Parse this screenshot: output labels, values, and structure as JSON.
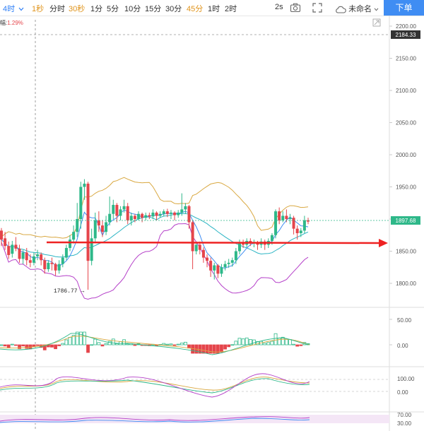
{
  "toolbar": {
    "interval_selected": "4时",
    "intervals": [
      "1秒",
      "分时",
      "30秒",
      "1分",
      "5分",
      "10分",
      "15分",
      "30分",
      "45分",
      "1时",
      "2时"
    ],
    "refresh": "2s",
    "cloud_label": "未命名",
    "order_button": "下单"
  },
  "legend": {
    "label": "幅:",
    "value": "1.29%"
  },
  "colors": {
    "up": "#2eb889",
    "down": "#e5454b",
    "accent": "#2e7ff7",
    "boll_upper": "#d9a841",
    "boll_lower": "#b540c9",
    "arrow": "#ee2222"
  },
  "icons": [
    "chevron-down-icon",
    "camera-icon",
    "fullscreen-icon",
    "cloud-icon",
    "collapse-icon"
  ],
  "chart_data": {
    "type": "candlestick",
    "price_axis": {
      "ticks": [
        "2200.00",
        "2150.00",
        "2100.00",
        "2050.00",
        "2000.00",
        "1950.00",
        "1900.00",
        "1850.00",
        "1800.00"
      ],
      "ylim": [
        1790,
        2205
      ]
    },
    "markers": {
      "high_dashed": "2184.33",
      "last_price": "1897.68",
      "low_label": "1786.77"
    },
    "candles": [
      [
        1882,
        1868,
        1886,
        1858
      ],
      [
        1870,
        1858,
        1880,
        1852
      ],
      [
        1858,
        1844,
        1865,
        1838
      ],
      [
        1846,
        1860,
        1866,
        1840
      ],
      [
        1860,
        1854,
        1872,
        1850
      ],
      [
        1854,
        1838,
        1860,
        1832
      ],
      [
        1838,
        1848,
        1852,
        1830
      ],
      [
        1848,
        1836,
        1855,
        1828
      ],
      [
        1836,
        1832,
        1845,
        1825
      ],
      [
        1832,
        1842,
        1848,
        1828
      ],
      [
        1842,
        1845,
        1852,
        1836
      ],
      [
        1845,
        1836,
        1848,
        1828
      ],
      [
        1836,
        1822,
        1840,
        1815
      ],
      [
        1822,
        1832,
        1836,
        1818
      ],
      [
        1832,
        1830,
        1840,
        1820
      ],
      [
        1830,
        1820,
        1832,
        1812
      ],
      [
        1820,
        1830,
        1836,
        1815
      ],
      [
        1830,
        1840,
        1845,
        1825
      ],
      [
        1840,
        1855,
        1860,
        1836
      ],
      [
        1855,
        1868,
        1875,
        1850
      ],
      [
        1868,
        1880,
        1890,
        1862
      ],
      [
        1880,
        1900,
        1925,
        1872
      ],
      [
        1900,
        1950,
        1958,
        1885
      ],
      [
        1950,
        1955,
        1962,
        1930
      ],
      [
        1955,
        1835,
        1958,
        1790
      ],
      [
        1835,
        1870,
        1885,
        1828
      ],
      [
        1870,
        1898,
        1910,
        1865
      ],
      [
        1898,
        1890,
        1912,
        1880
      ],
      [
        1890,
        1880,
        1898,
        1872
      ],
      [
        1880,
        1895,
        1905,
        1875
      ],
      [
        1895,
        1908,
        1935,
        1890
      ],
      [
        1908,
        1922,
        1930,
        1900
      ],
      [
        1922,
        1905,
        1925,
        1895
      ],
      [
        1905,
        1915,
        1920,
        1898
      ],
      [
        1915,
        1920,
        1930,
        1910
      ],
      [
        1920,
        1898,
        1925,
        1892
      ],
      [
        1898,
        1905,
        1910,
        1890
      ],
      [
        1905,
        1900,
        1908,
        1895
      ],
      [
        1900,
        1908,
        1912,
        1898
      ],
      [
        1908,
        1902,
        1910,
        1895
      ],
      [
        1902,
        1906,
        1910,
        1898
      ],
      [
        1906,
        1904,
        1910,
        1900
      ],
      [
        1904,
        1910,
        1915,
        1900
      ],
      [
        1910,
        1905,
        1912,
        1898
      ],
      [
        1905,
        1908,
        1912,
        1902
      ],
      [
        1908,
        1912,
        1915,
        1904
      ],
      [
        1912,
        1908,
        1916,
        1903
      ],
      [
        1908,
        1910,
        1914,
        1900
      ],
      [
        1910,
        1906,
        1912,
        1898
      ],
      [
        1906,
        1910,
        1914,
        1902
      ],
      [
        1910,
        1915,
        1940,
        1905
      ],
      [
        1915,
        1920,
        1925,
        1908
      ],
      [
        1920,
        1895,
        1922,
        1885
      ],
      [
        1895,
        1850,
        1898,
        1822
      ],
      [
        1850,
        1860,
        1864,
        1845
      ],
      [
        1860,
        1852,
        1865,
        1845
      ],
      [
        1852,
        1840,
        1856,
        1832
      ],
      [
        1840,
        1835,
        1845,
        1825
      ],
      [
        1835,
        1820,
        1840,
        1810
      ],
      [
        1820,
        1828,
        1832,
        1806
      ],
      [
        1828,
        1815,
        1830,
        1808
      ],
      [
        1815,
        1825,
        1830,
        1810
      ],
      [
        1825,
        1830,
        1835,
        1820
      ],
      [
        1830,
        1832,
        1838,
        1824
      ],
      [
        1832,
        1836,
        1840,
        1826
      ],
      [
        1836,
        1850,
        1855,
        1830
      ],
      [
        1850,
        1862,
        1868,
        1845
      ],
      [
        1862,
        1860,
        1868,
        1855
      ],
      [
        1860,
        1866,
        1870,
        1856
      ],
      [
        1866,
        1862,
        1870,
        1858
      ],
      [
        1862,
        1864,
        1868,
        1856
      ],
      [
        1864,
        1860,
        1866,
        1852
      ],
      [
        1860,
        1865,
        1870,
        1855
      ],
      [
        1865,
        1860,
        1868,
        1852
      ],
      [
        1860,
        1866,
        1870,
        1855
      ],
      [
        1866,
        1875,
        1878,
        1860
      ],
      [
        1875,
        1912,
        1915,
        1870
      ],
      [
        1912,
        1898,
        1918,
        1892
      ],
      [
        1898,
        1905,
        1912,
        1895
      ],
      [
        1905,
        1900,
        1915,
        1895
      ],
      [
        1900,
        1902,
        1908,
        1892
      ],
      [
        1902,
        1885,
        1905,
        1876
      ],
      [
        1885,
        1878,
        1890,
        1868
      ],
      [
        1878,
        1882,
        1886,
        1872
      ],
      [
        1882,
        1898,
        1905,
        1878
      ],
      [
        1898,
        1896,
        1902,
        1892
      ]
    ]
  }
}
